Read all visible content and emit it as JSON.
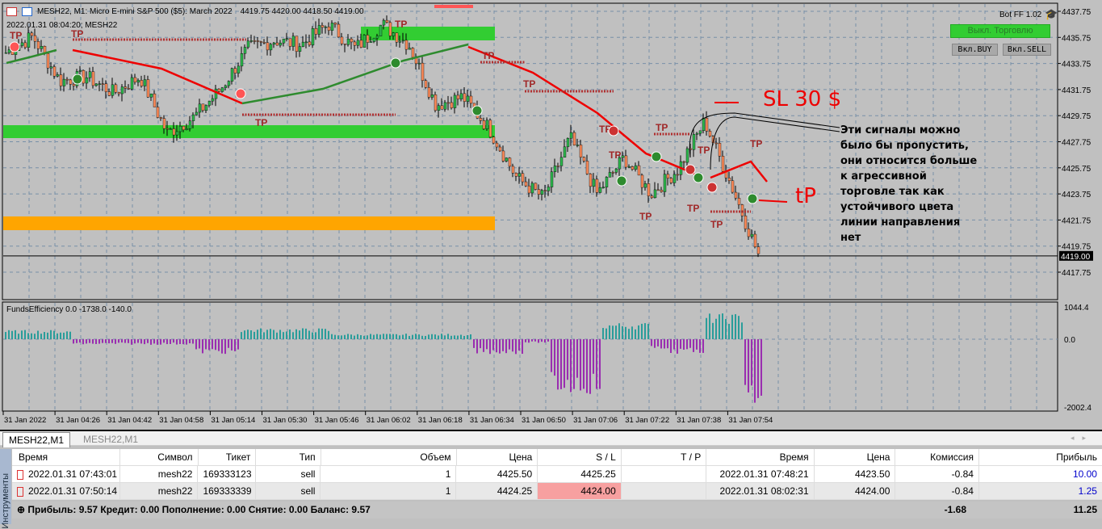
{
  "header": {
    "title": "MESH22, M1:  Micro E-mini S&P 500 ($5): March 2022",
    "ohlc": "4419.75 4420.00 4418.50 4419.00",
    "subtitle": "2022.01.31 08:04:20; MESH22"
  },
  "bot": {
    "name": "Bot FF 1.02",
    "icon": "graduation-cap-icon",
    "trade_off_label": "Выкл. Торговлю",
    "buy_label": "Вкл.BUY",
    "sell_label": "Вкл.SELL"
  },
  "price_axis": {
    "labels": [
      "4437.75",
      "4435.75",
      "4433.75",
      "4431.75",
      "4429.75",
      "4427.75",
      "4425.75",
      "4423.75",
      "4421.75",
      "4419.75",
      "4417.75"
    ],
    "current_price": "4419.00"
  },
  "indicator": {
    "title": "FundsEfficiency 0.0 -1738.0 -140.0",
    "axis_labels": [
      "1044.4",
      "0.0",
      "-2002.4"
    ],
    "positive_color": "#2a9d9a",
    "negative_color": "#9a2db0"
  },
  "time_axis": [
    "31 Jan 2022",
    "31 Jan 04:26",
    "31 Jan 04:42",
    "31 Jan 04:58",
    "31 Jan 05:14",
    "31 Jan 05:30",
    "31 Jan 05:46",
    "31 Jan 06:02",
    "31 Jan 06:18",
    "31 Jan 06:34",
    "31 Jan 06:50",
    "31 Jan 07:06",
    "31 Jan 07:22",
    "31 Jan 07:38",
    "31 Jan 07:54"
  ],
  "chart_data": {
    "type": "candlestick",
    "price_path": [
      4434.59,
      4435.83,
      4432.42,
      4432.73,
      4431.5,
      4432.73,
      4428.4,
      4429.64,
      4431.8,
      4434.9,
      4435.52,
      4435.2,
      4436.76,
      4434.9,
      4436.76,
      4435.2,
      4430.57,
      4431.19,
      4428.71,
      4425.0,
      4423.45,
      4428.09,
      4423.75,
      4426.54,
      4423.75,
      4425.61,
      4429.33,
      4424.38,
      4419.1
    ],
    "bull_color": "#2db84d",
    "bear_color": "#ff8c5a",
    "histogram_segments": [
      {
        "from": 0,
        "to": 20,
        "value": 250
      },
      {
        "from": 21,
        "to": 58,
        "value": -150
      },
      {
        "from": 59,
        "to": 72,
        "value": -400
      },
      {
        "from": 73,
        "to": 100,
        "value": 300
      },
      {
        "from": 101,
        "to": 144,
        "value": 150
      },
      {
        "from": 145,
        "to": 160,
        "value": -400
      },
      {
        "from": 161,
        "to": 168,
        "value": -100
      },
      {
        "from": 169,
        "to": 184,
        "value": -1500
      },
      {
        "from": 185,
        "to": 199,
        "value": 450
      },
      {
        "from": 200,
        "to": 203,
        "value": -300
      },
      {
        "from": 204,
        "to": 216,
        "value": -400
      },
      {
        "from": 217,
        "to": 228,
        "value": 700
      },
      {
        "from": 229,
        "to": 234,
        "value": -1800
      }
    ]
  },
  "annotations": {
    "sl": "SL 30 $",
    "tp": "tP",
    "tp_label": "TP",
    "note": "Эти сигналы можно было бы пропустить, они относится больше к агрессивной торговле так как устойчивого цвета линии направления нет"
  },
  "tabs": [
    {
      "label": "MESH22,M1"
    },
    {
      "label": "MESH22,M1"
    }
  ],
  "side_panel": {
    "label": "Инструменты"
  },
  "table": {
    "columns": [
      "Время",
      "Символ",
      "Тикет",
      "Тип",
      "Объем",
      "Цена",
      "S / L",
      "T / P",
      "Время",
      "Цена",
      "Комиссия",
      "Прибыль"
    ],
    "rows": [
      [
        "2022.01.31 07:43:01",
        "mesh22",
        "169333123",
        "sell",
        "1",
        "4425.50",
        "4425.25",
        "",
        "2022.01.31 07:48:21",
        "4423.50",
        "-0.84",
        "10.00"
      ],
      [
        "2022.01.31 07:50:14",
        "mesh22",
        "169333339",
        "sell",
        "1",
        "4424.25",
        "4424.00",
        "",
        "2022.01.31 08:02:31",
        "4424.00",
        "-0.84",
        "1.25"
      ]
    ],
    "summary": "Прибыль: 9.57  Кредит: 0.00  Пополнение: 0.00  Снятие: 0.00  Баланс: 9.57",
    "total_commission": "-1.68",
    "total_profit": "11.25"
  }
}
